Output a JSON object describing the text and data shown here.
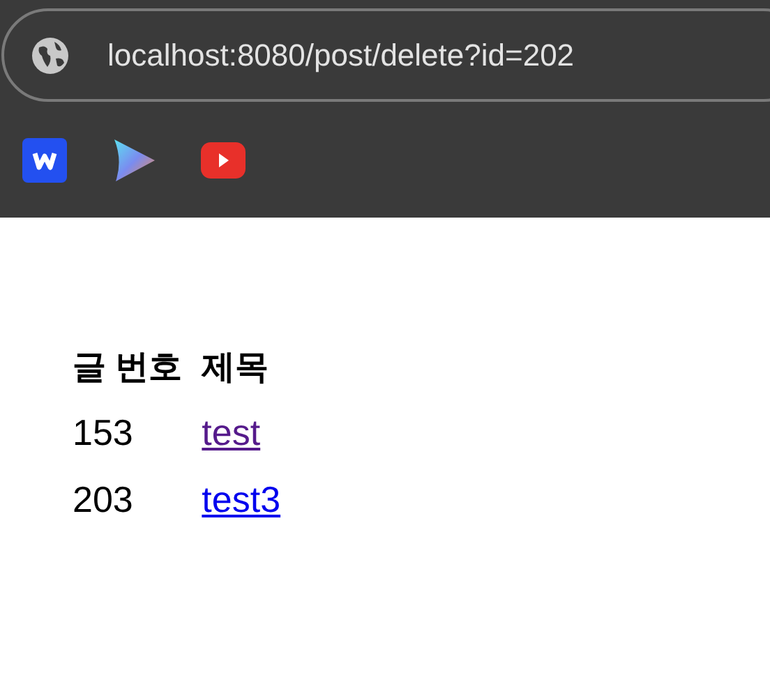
{
  "browser": {
    "url": "localhost:8080/post/delete?id=202"
  },
  "table": {
    "columns": [
      "글 번호",
      "제목"
    ],
    "rows": [
      {
        "number": "153",
        "title": "test",
        "visited": true
      },
      {
        "number": "203",
        "title": "test3",
        "visited": false
      }
    ]
  }
}
